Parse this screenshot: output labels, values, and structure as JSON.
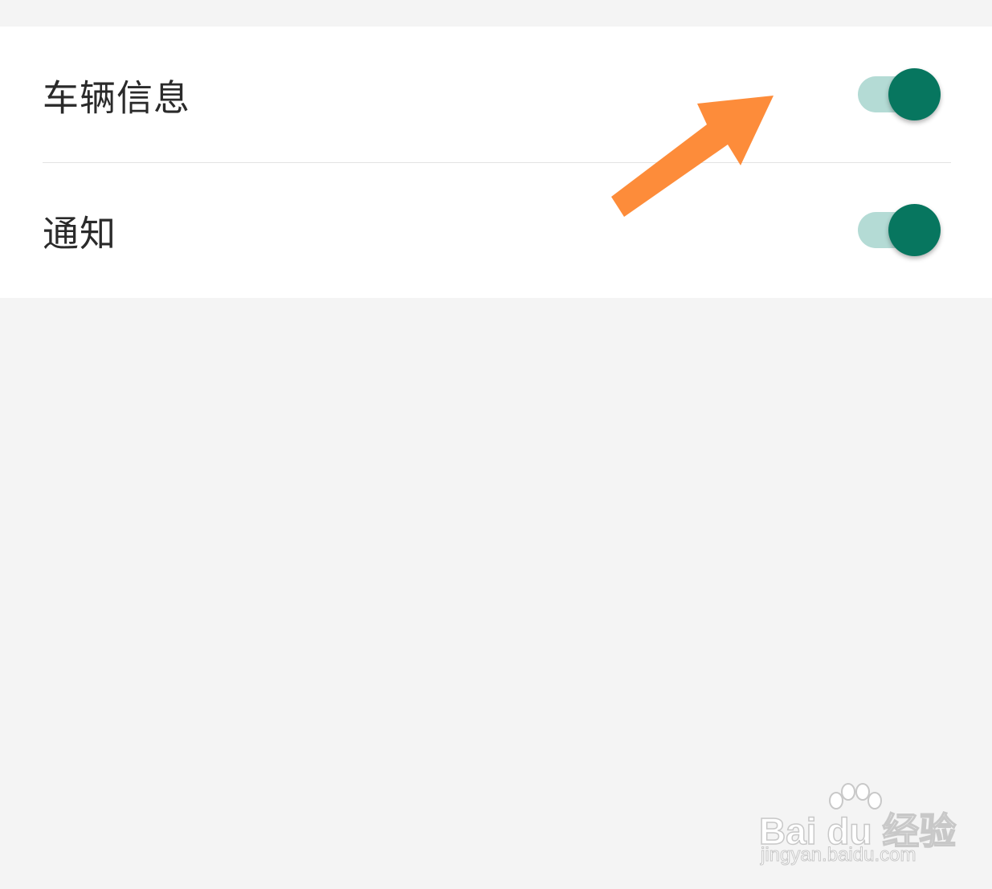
{
  "settings": {
    "items": [
      {
        "label": "车辆信息",
        "enabled": true
      },
      {
        "label": "通知",
        "enabled": true
      }
    ]
  },
  "colors": {
    "toggle_thumb_on": "#07765f",
    "toggle_track_on": "#b4dbd5",
    "annotation_arrow": "#fd8c3a",
    "page_background": "#f4f4f4",
    "panel_background": "#ffffff"
  },
  "watermark": {
    "brand": "Bai du 经验",
    "url": "jingyan.baidu.com"
  }
}
